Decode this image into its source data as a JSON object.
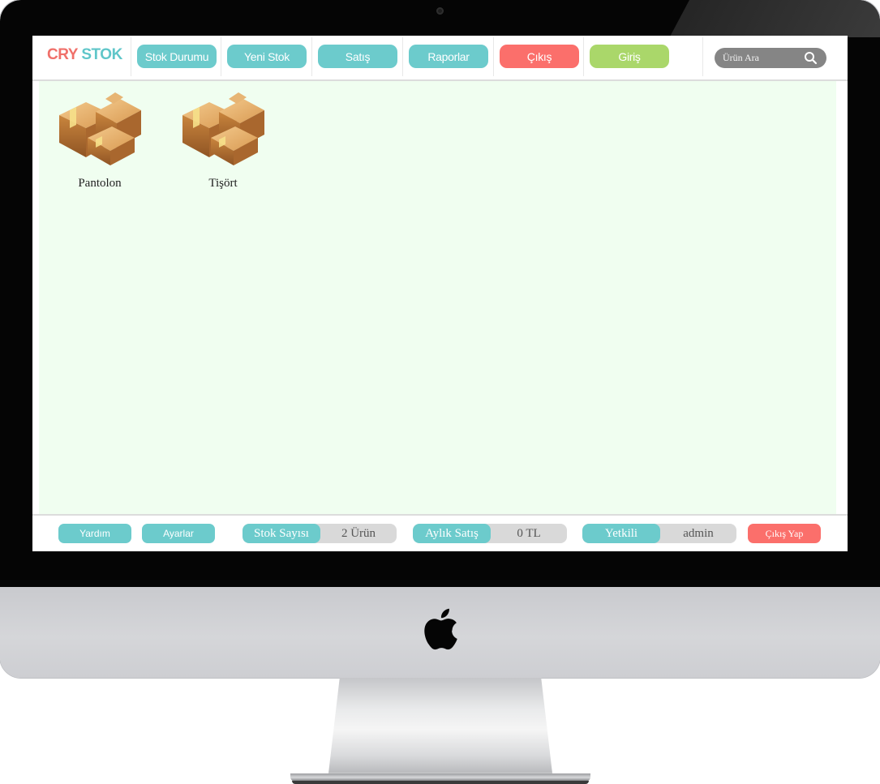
{
  "app": {
    "logo_part1": "CRY",
    "logo_part2": "STOK"
  },
  "nav": {
    "items": [
      {
        "label": "Stok Durumu",
        "color": "#6ccbcc"
      },
      {
        "label": "Yeni Stok",
        "color": "#6ccbcc"
      },
      {
        "label": "Satış",
        "color": "#6ccbcc"
      },
      {
        "label": "Raporlar",
        "color": "#6ccbcc"
      },
      {
        "label": "Çıkış",
        "color": "#fb6f6b"
      },
      {
        "label": "Giriş",
        "color": "#aad76a"
      }
    ]
  },
  "search": {
    "placeholder": "Ürün Ara",
    "icon": "search-icon"
  },
  "products": [
    {
      "name": "Pantolon",
      "icon": "box-icon"
    },
    {
      "name": "Tişört",
      "icon": "box-icon"
    }
  ],
  "footer": {
    "help_label": "Yardım",
    "settings_label": "Ayarlar",
    "stock_count_key": "Stok Sayısı",
    "stock_count_value": "2 Ürün",
    "monthly_sales_key": "Aylık Satış",
    "monthly_sales_value": "0 TL",
    "user_key": "Yetkili",
    "user_value": "admin",
    "logout_label": "Çıkış Yap"
  },
  "colors": {
    "accent": "#6ccbcc",
    "danger": "#fb6f6b",
    "success": "#aad76a",
    "content_bg": "#f0fef0"
  }
}
